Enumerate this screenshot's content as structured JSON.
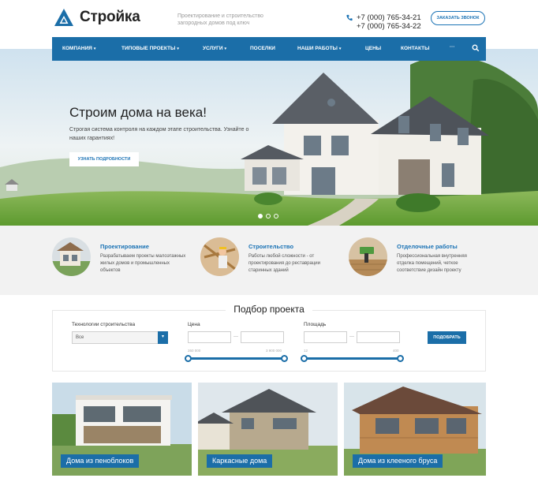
{
  "brand": {
    "name": "Стройка",
    "tagline": "Проектирование и строительство загородных домов под ключ"
  },
  "contacts": {
    "phones": [
      "+7 (000) 765-34-21",
      "+7 (000) 765-34-22"
    ],
    "callback_label": "Заказать звонок"
  },
  "nav": {
    "items": [
      {
        "label": "Компания",
        "dropdown": true
      },
      {
        "label": "Типовые проекты",
        "dropdown": true
      },
      {
        "label": "Услуги",
        "dropdown": true
      },
      {
        "label": "Поселки",
        "dropdown": false
      },
      {
        "label": "Наши работы",
        "dropdown": true
      },
      {
        "label": "Цены",
        "dropdown": false
      },
      {
        "label": "Контакты",
        "dropdown": false
      },
      {
        "label": "···",
        "dropdown": false
      }
    ],
    "search_icon": "search-icon"
  },
  "hero": {
    "title": "Строим дома на века!",
    "subtitle": "Строгая система контроля на каждом этапе строительства. Узнайте о наших гарантиях!",
    "button_label": "Узнать подробности",
    "slides_total": 3,
    "active_slide": 1
  },
  "features": [
    {
      "title": "Проектирование",
      "description": "Разрабатываем проекты малоэтажных жилых домов и промышленных объектов"
    },
    {
      "title": "Строительство",
      "description": "Работы любой сложности - от проектирования до реставрации старинных зданий"
    },
    {
      "title": "Отделочные работы",
      "description": "Профессиональная внутренняя отделка помещений, четкое соответствие дизайн проекту"
    }
  ],
  "filter": {
    "title": "Подбор проекта",
    "technology": {
      "label": "Технологии строительства",
      "value": "Все"
    },
    "price": {
      "label": "Цена",
      "min_text": "260 000",
      "max_text": "3 900 000",
      "dash": "—"
    },
    "area": {
      "label": "Площадь",
      "min_text": "12",
      "max_text": "400",
      "dash": "—"
    },
    "submit_label": "Подобрать"
  },
  "categories": [
    {
      "label": "Дома из пеноблоков"
    },
    {
      "label": "Каркасные дома"
    },
    {
      "label": "Дома из клееного бруса"
    }
  ],
  "colors": {
    "accent": "#1b6ea8",
    "link": "#1b73b5",
    "features_bg": "#f2f2f2"
  }
}
